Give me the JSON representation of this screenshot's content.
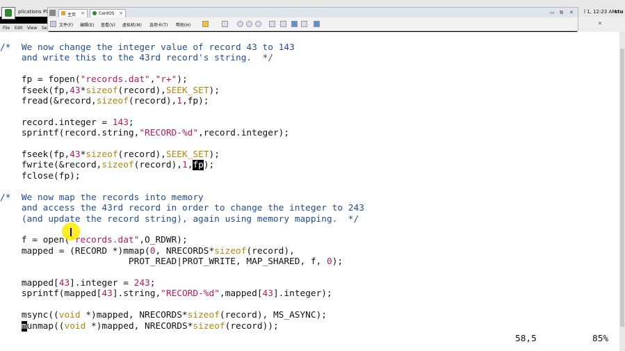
{
  "gnome_panel": {
    "apps_label": "plications",
    "places_label": "Pl",
    "clock": "l 1, 12:23 AM",
    "user": "stu"
  },
  "terminal_menu": [
    "File",
    "Edit",
    "View",
    "Se"
  ],
  "vm": {
    "tabs": [
      {
        "label": "主页",
        "icon": "home-icon"
      },
      {
        "label": "CentOS",
        "icon": "vm-icon"
      }
    ],
    "menu": [
      "文件(F)",
      "编辑(E)",
      "查看(V)",
      "虚拟机(M)",
      "选项卡(T)",
      "帮助(H)"
    ],
    "window_controls": [
      "▭",
      "⧉",
      "✕"
    ]
  },
  "editor": {
    "lines": [
      "/*  We now change the integer value of record 43 to 143",
      "    and write this to the 43rd record's string.  */",
      "",
      "    fp = fopen(\"records.dat\",\"r+\");",
      "    fseek(fp,43*sizeof(record),SEEK_SET);",
      "    fread(&record,sizeof(record),1,fp);",
      "",
      "    record.integer = 143;",
      "    sprintf(record.string,\"RECORD-%d\",record.integer);",
      "",
      "    fseek(fp,43*sizeof(record),SEEK_SET);",
      "    fwrite(&record,sizeof(record),1,fp);",
      "    fclose(fp);",
      "",
      "/*  We now map the records into memory",
      "    and access the 43rd record in order to change the integer to 243",
      "    (and update the record string), again using memory mapping.  */",
      "",
      "    f = open(\"records.dat\",O_RDWR);",
      "    mapped = (RECORD *)mmap(0, NRECORDS*sizeof(record),",
      "                        PROT_READ|PROT_WRITE, MAP_SHARED, f, 0);",
      "",
      "    mapped[43].integer = 243;",
      "    sprintf(mapped[43].string,\"RECORD-%d\",mapped[43].integer);",
      "",
      "    msync((void *)mapped, NRECORDS*sizeof(record), MS_ASYNC);",
      "    munmap((void *)mapped, NRECORDS*sizeof(record));"
    ],
    "status_position": "58,5",
    "status_percent": "85%"
  },
  "colors": {
    "comment": "#1f4e9a",
    "string": "#c2185b",
    "keyword": "#b8860b"
  }
}
